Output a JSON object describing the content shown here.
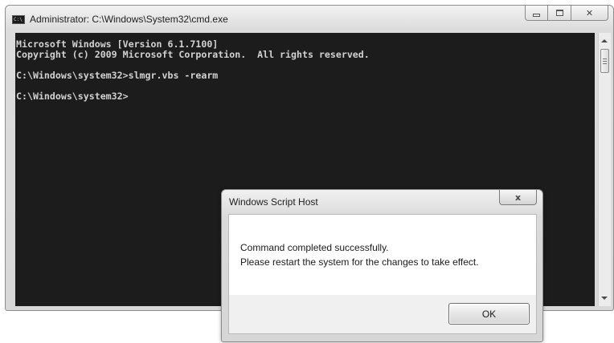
{
  "cmd_window": {
    "title": "Administrator: C:\\Windows\\System32\\cmd.exe",
    "icon": "cmd-console-icon",
    "console_lines": [
      "Microsoft Windows [Version 6.1.7100]",
      "Copyright (c) 2009 Microsoft Corporation.  All rights reserved.",
      "",
      "C:\\Windows\\system32>slmgr.vbs -rearm",
      "",
      "C:\\Windows\\system32>"
    ],
    "caption_buttons": [
      "minimize-icon",
      "maximize-icon",
      "close-icon"
    ],
    "close_glyph": "✕"
  },
  "dialog": {
    "title": "Windows Script Host",
    "close_glyph": "x",
    "message_lines": [
      "Command completed successfully.",
      "Please restart the system for the changes to take effect."
    ],
    "ok_label": "OK"
  },
  "colors": {
    "console_background": "#1c1c1c",
    "console_text": "#d2d2d2",
    "chrome": "#dcdcdc",
    "dialog_body": "#ffffff"
  }
}
